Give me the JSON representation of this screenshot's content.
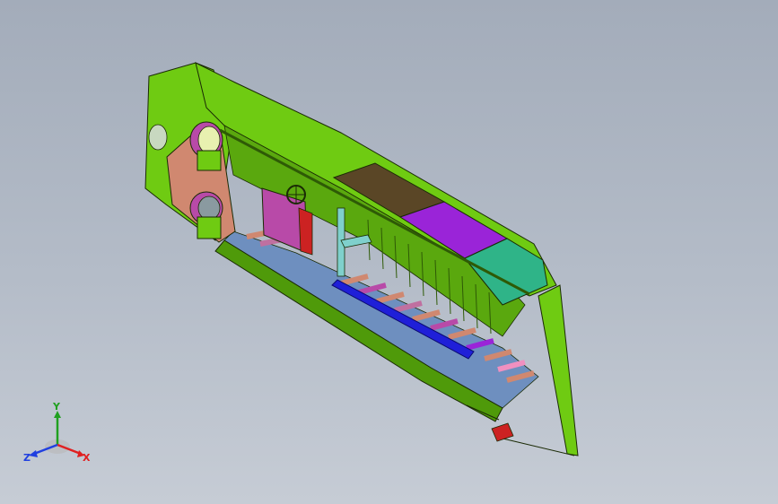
{
  "viewport": {
    "background_top": "#a3acba",
    "background_bottom": "#c6ccd5"
  },
  "model": {
    "colors": {
      "hull": "#6fcb12",
      "hull_dark": "#4f9a0a",
      "hull_shadow": "#5aa80e",
      "outline": "#1a2a05",
      "hatch_brown": "#5a4626",
      "hatch_purple": "#9a24d8",
      "hatch_teal": "#2fb488",
      "floor_blue": "#6e8fbf",
      "rod_blue": "#1f1fd8",
      "panel_magenta": "#b84aa8",
      "panel_red": "#cc2222",
      "post_cyan": "#7fd0cc",
      "salmon": "#d08870",
      "pink": "#f090c0"
    }
  },
  "triad": {
    "x_label": "X",
    "y_label": "Y",
    "z_label": "Z",
    "x_color": "#e02020",
    "y_color": "#20a020",
    "z_color": "#2040e0"
  }
}
